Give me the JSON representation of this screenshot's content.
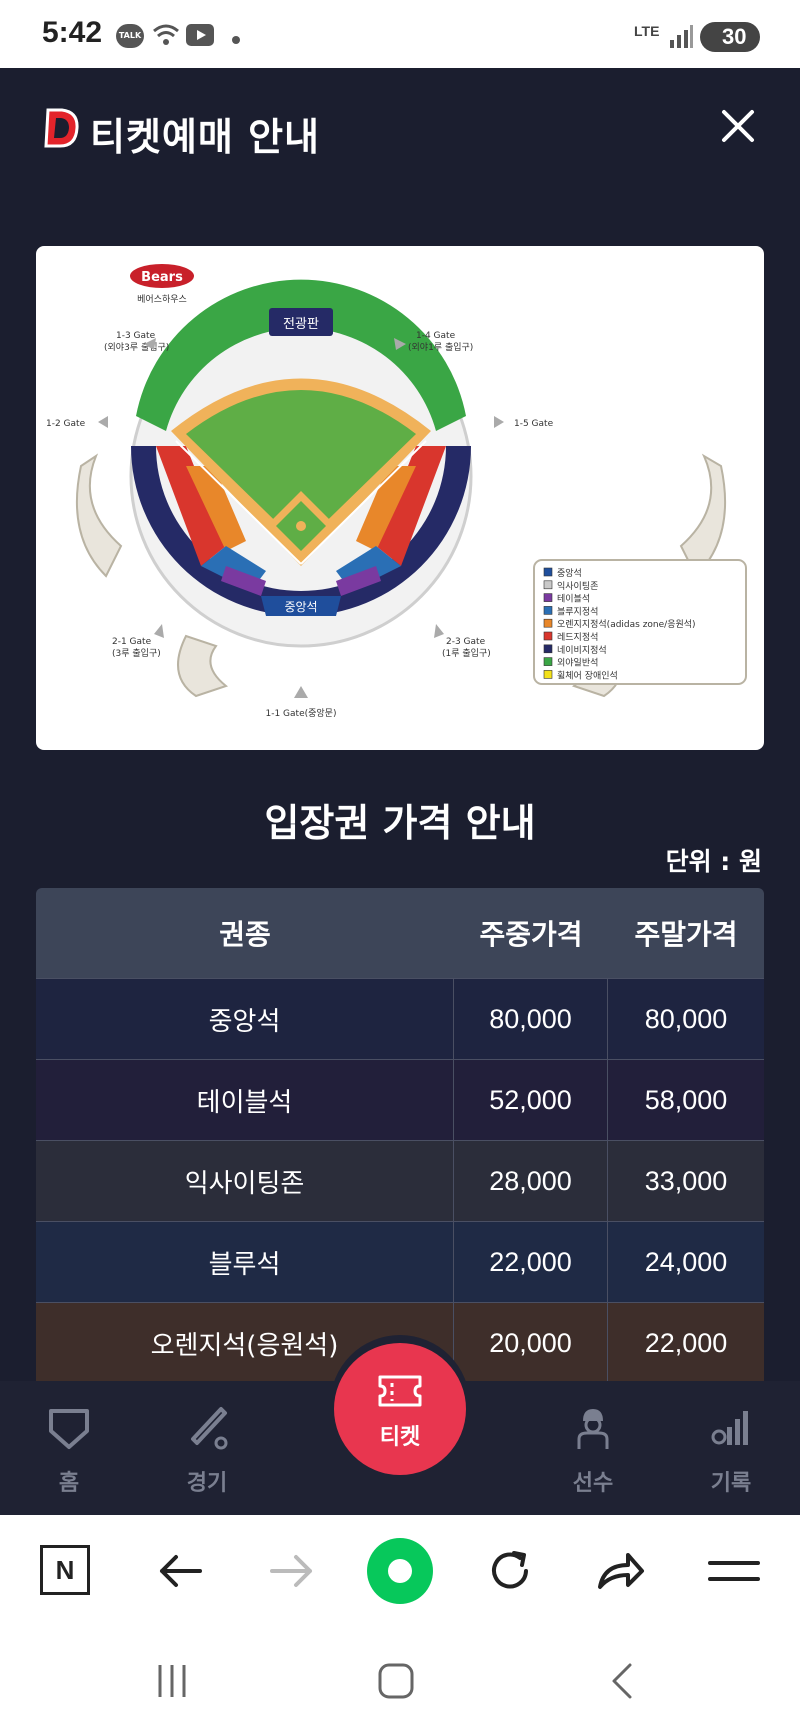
{
  "status_bar": {
    "time": "5:42",
    "talk_badge": "TALK",
    "network": "LTE",
    "battery": "30"
  },
  "header": {
    "title": "티켓예매 안내",
    "logo_letter": "D"
  },
  "stadium_map": {
    "team_logo": "Bears",
    "house_label": "베어스하우스",
    "scoreboard_label": "전광판",
    "center_label": "중앙석",
    "gates": {
      "g13": "1-3 Gate",
      "g13_sub": "(외야3루 출입구)",
      "g14": "1-4 Gate",
      "g14_sub": "(외야1루 출입구)",
      "g12": "1-2 Gate",
      "g15": "1-5 Gate",
      "g21": "2-1 Gate",
      "g21_sub": "(3루 출입구)",
      "g23": "2-3 Gate",
      "g23_sub": "(1루 출입구)",
      "g11": "1-1 Gate(중앙문)"
    },
    "legend": [
      {
        "label": "중앙석",
        "color": "#1f4e9c"
      },
      {
        "label": "익사이팅존",
        "color": "#c9c9c9"
      },
      {
        "label": "테이블석",
        "color": "#7a3aa0"
      },
      {
        "label": "블루지정석",
        "color": "#2a6fb5"
      },
      {
        "label": "오렌지지정석(adidas zone/응원석)",
        "color": "#e8872a"
      },
      {
        "label": "레드지정석",
        "color": "#d9362d"
      },
      {
        "label": "네이비지정석",
        "color": "#252a66"
      },
      {
        "label": "외야일반석",
        "color": "#3aa645"
      },
      {
        "label": "휠체어 장애인석",
        "color": "#f3e11a"
      }
    ]
  },
  "prices": {
    "title": "입장권 가격 안내",
    "unit": "단위 : 원",
    "headers": {
      "type": "권종",
      "weekday": "주중가격",
      "weekend": "주말가격"
    },
    "rows": [
      {
        "type": "중앙석",
        "weekday": "80,000",
        "weekend": "80,000",
        "bg": "#1e2440"
      },
      {
        "type": "테이블석",
        "weekday": "52,000",
        "weekend": "58,000",
        "bg": "#221f3a"
      },
      {
        "type": "익사이팅존",
        "weekday": "28,000",
        "weekend": "33,000",
        "bg": "#2b2d3a"
      },
      {
        "type": "블루석",
        "weekday": "22,000",
        "weekend": "24,000",
        "bg": "#1f2a45"
      },
      {
        "type": "오렌지석(응원석)",
        "weekday": "20,000",
        "weekend": "22,000",
        "bg": "#3e2e2a"
      }
    ]
  },
  "app_nav": {
    "home": "홈",
    "games": "경기",
    "ticket": "티켓",
    "players": "선수",
    "records": "기록"
  },
  "browser_bar": {
    "naver_letter": "N"
  },
  "colors": {
    "accent": "#e8364f",
    "background": "#1b1e2f",
    "table_header": "#3d4558"
  }
}
